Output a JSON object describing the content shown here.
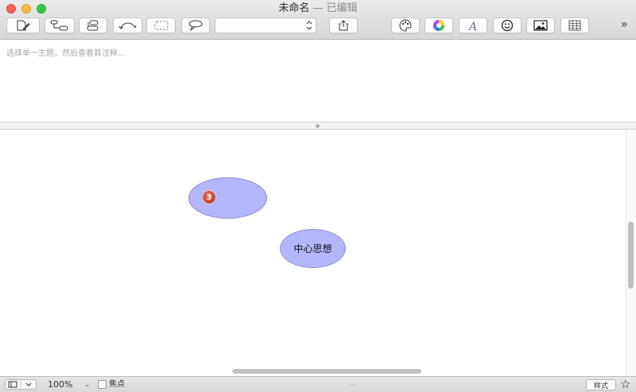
{
  "window": {
    "title": "未命名",
    "edited_status": "— 已编辑"
  },
  "toolbar": {
    "buttons": [
      {
        "name": "new-topic",
        "icon": "document-edit-icon"
      },
      {
        "name": "subtopic",
        "icon": "subtopic-icon"
      },
      {
        "name": "sibling-topic",
        "icon": "sibling-topic-icon"
      },
      {
        "name": "relationship",
        "icon": "relationship-arrow-icon"
      },
      {
        "name": "boundary",
        "icon": "boundary-icon"
      },
      {
        "name": "callout",
        "icon": "callout-icon"
      },
      {
        "name": "share",
        "icon": "share-icon"
      },
      {
        "name": "theme",
        "icon": "palette-icon"
      },
      {
        "name": "colors",
        "icon": "color-wheel-icon"
      },
      {
        "name": "fonts",
        "icon": "font-icon"
      },
      {
        "name": "emoji",
        "icon": "smiley-icon"
      },
      {
        "name": "image",
        "icon": "image-icon"
      },
      {
        "name": "table",
        "icon": "table-icon"
      }
    ],
    "select_value": "",
    "more_label": "»"
  },
  "notes": {
    "placeholder": "选择单一主题，然后查看其注释..."
  },
  "canvas": {
    "floating_topic": {
      "badge": "3",
      "color": "#b3b6fb"
    },
    "central_topic": {
      "label": "中心思想",
      "color": "#b3b6fb"
    }
  },
  "statusbar": {
    "zoom": "100%",
    "zoom_arrow": "⌄",
    "focus_label": "焦点",
    "focus_checked": false,
    "dots": "...",
    "style_button": "样式",
    "star": "☆"
  }
}
